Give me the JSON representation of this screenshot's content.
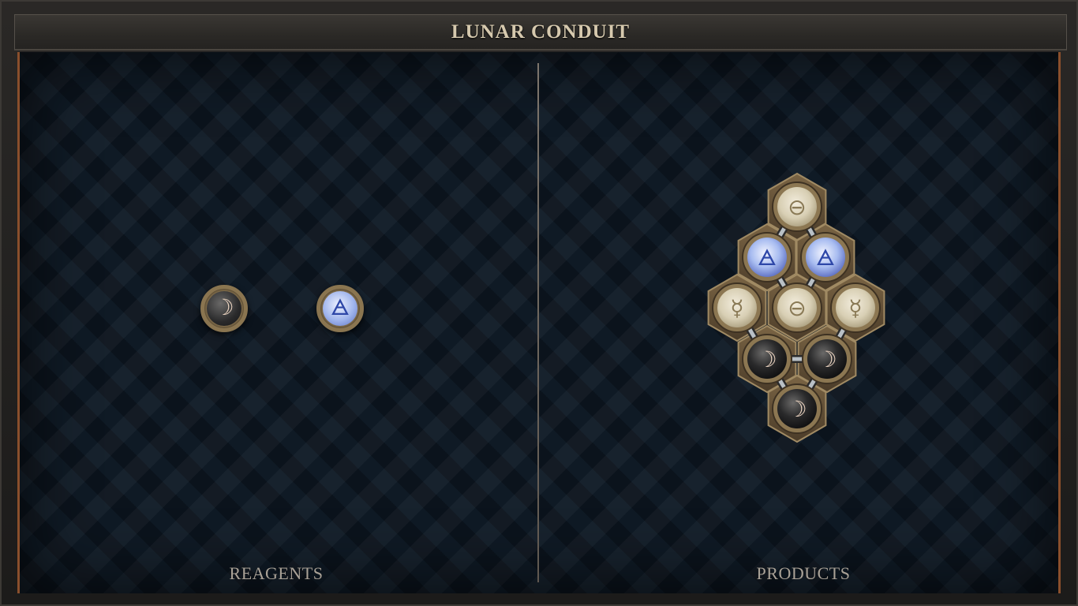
{
  "title": "LUNAR CONDUIT",
  "panels": {
    "left_label": "REAGENTS",
    "right_label": "PRODUCTS"
  },
  "reagents": [
    {
      "element": "moon",
      "glyph": "☽"
    },
    {
      "element": "air",
      "glyph": "🜁"
    }
  ],
  "product_molecule": {
    "atoms": [
      {
        "element": "salt",
        "glyph": "⊖"
      },
      {
        "element": "air",
        "glyph": "🜁"
      },
      {
        "element": "air",
        "glyph": "🜁"
      },
      {
        "element": "quicksilver",
        "glyph": "☿"
      },
      {
        "element": "salt",
        "glyph": "⊖"
      },
      {
        "element": "quicksilver",
        "glyph": "☿"
      },
      {
        "element": "moon",
        "glyph": "☽"
      },
      {
        "element": "moon",
        "glyph": "☽"
      },
      {
        "element": "moon",
        "glyph": "☽"
      }
    ],
    "bonds": [
      [
        0,
        1
      ],
      [
        0,
        2
      ],
      [
        1,
        4
      ],
      [
        2,
        4
      ],
      [
        3,
        6
      ],
      [
        5,
        7
      ],
      [
        6,
        7
      ],
      [
        6,
        8
      ],
      [
        7,
        8
      ]
    ]
  },
  "colors": {
    "board": "#0f1a25",
    "title_text": "#d6c9ae",
    "label_text": "#a9a196",
    "bronze": "#8a7550",
    "salt": "#e3dcc8",
    "air": "#9fb4ec",
    "moon": "#2a2a2b"
  }
}
